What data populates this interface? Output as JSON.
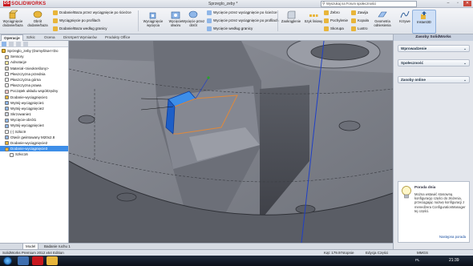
{
  "titlebar": {
    "app": "SOLIDWORKS",
    "doc_title": "Sprzeglo_zeby *",
    "search_placeholder": "Wyszukaj na Forum społeczności"
  },
  "ribbon": {
    "big": [
      {
        "label": "Wyciągnięcie dodanie/baza"
      },
      {
        "label": "Obrót dodanie/baza"
      },
      {
        "label": "Wyciągnięcie wycięcia"
      },
      {
        "label": "Wycięcie otworu"
      },
      {
        "label": "Wycięcie przez obrót"
      },
      {
        "label": "Zaokrąglenie"
      },
      {
        "label": "Szyk liniowy"
      },
      {
        "label": "Geometria odniesienia"
      },
      {
        "label": "Krzywe"
      },
      {
        "label": "Instant3D"
      }
    ],
    "small": [
      "Dodanie/Baza przez wyciągnięcie po ścieżce",
      "Wyciągnięcie po profilach",
      "Dodanie/Baza według granicy",
      "Wycięcie przez wyciągnięcie po ścieżce",
      "Wycięcie przez wyciągnięcie po profilach",
      "Wycięcie według granicy",
      "Żebro",
      "Pochylenie",
      "Skorupa",
      "Zawija",
      "Kopuła",
      "Lustro"
    ]
  },
  "tabs": [
    "Operacje",
    "Szkic",
    "Ocena",
    "DimXpert Wymiarów",
    "Produkty Office"
  ],
  "tree": {
    "root": "Sprzeglo_zeby (Domyślna<<Do",
    "items": [
      "Sensory",
      "Adnotacje",
      "Materiał <nieokreślony>",
      "Płaszczyzna przednia",
      "Płaszczyzna górna",
      "Płaszczyzna prawa",
      "Początek układu współrzędny",
      "Dodanie-wyciągnięcie1",
      "Wytnij-wyciągnięcie1",
      "Wytnij-wyciągnięcie2",
      "Skrzowanie1",
      "Wycięcie-obrót1",
      "Wytnij-wyciągnięcie4",
      "(-) Szkic9",
      "Otwór gwintowany M20x2.8",
      "Dodanie-wyciągnięcie2",
      "Dodanie-wyciągnięcie3",
      "Szkic16"
    ]
  },
  "bottom_tabs": [
    "Model",
    "Badanie ruchu 1"
  ],
  "taskpane": {
    "title": "Zasoby SolidWorks",
    "groups": [
      "Wprowadzenie",
      "Społeczność",
      "Zasoby online"
    ],
    "tip_title": "Porada dnia",
    "tip_text": "Można wstawić stosowną konfigurację części do złożenia, przeciągając nazwę konfiguracji z menedżera ConfigurationManager tej części.",
    "tip_next": "Następna porada"
  },
  "status": {
    "edition": "SolidWorks Premium 2012 x64 Edition",
    "angle": "Kąt: 179.97stopnie",
    "mode": "Edycja Części",
    "units": "MMGS"
  },
  "taskbar": {
    "lang": "PL",
    "time": "21:39"
  },
  "colors": {
    "accent": "#3d8ee8",
    "model_grey": "#7c7f88",
    "selection_blue": "#1e5fc7",
    "sketch_orange": "#e0883a"
  }
}
